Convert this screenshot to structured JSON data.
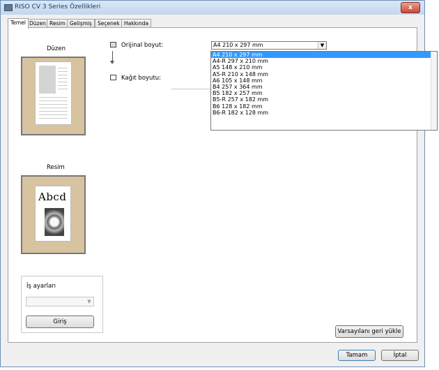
{
  "window": {
    "title": "RISO CV 3 Series Özellikleri"
  },
  "tabs": [
    {
      "label": "Temel",
      "active": true
    },
    {
      "label": "Düzen",
      "active": false
    },
    {
      "label": "Resim",
      "active": false
    },
    {
      "label": "Gelişmiş",
      "active": false
    },
    {
      "label": "Seçenek",
      "active": false
    },
    {
      "label": "Hakkında",
      "active": false
    }
  ],
  "sections": {
    "layout_label": "Düzen",
    "image_label": "Resim",
    "preview_text": "Abcd"
  },
  "fields": {
    "original_size_label": "Orijinal boyut:",
    "original_size_value": "A4 210 x 297 mm",
    "paper_size_label": "Kağıt boyutu:"
  },
  "dropdown": {
    "options": [
      "A4 210 x 297 mm",
      "A4-R 297 x 210 mm",
      "A5 148 x 210 mm",
      "A5-R 210 x 148 mm",
      "A6 105 x 148 mm",
      "B4 257 x 364 mm",
      "B5 182 x 257 mm",
      "B5-R 257 x 182 mm",
      "B6 128 x 182 mm",
      "B6-R 182 x 128 mm"
    ],
    "selected": "A4 210 x 297 mm"
  },
  "job_settings": {
    "label": "İş ayarları",
    "value": "",
    "entry_button": "Giriş"
  },
  "buttons": {
    "restore_defaults": "Varsayılanı geri yükle",
    "ok": "Tamam",
    "cancel": "İptal",
    "close": "x"
  },
  "colors": {
    "selection": "#3399ff",
    "preview_bg": "#d8c3a0"
  }
}
